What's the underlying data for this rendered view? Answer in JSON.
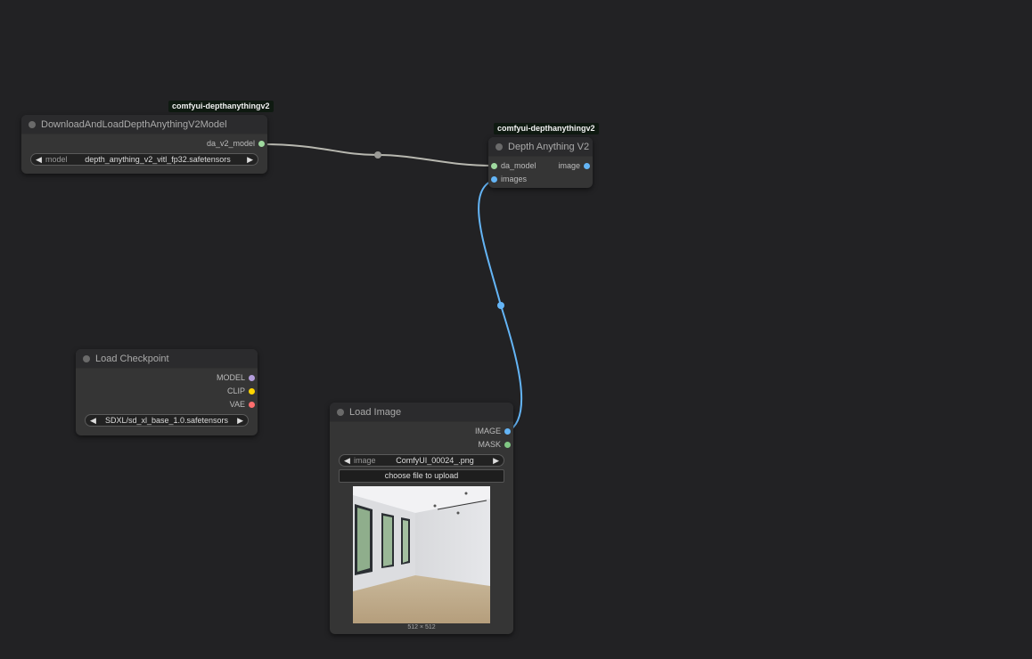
{
  "badges": {
    "download_node": "comfyui-depthanythingv2",
    "depth_node": "comfyui-depthanythingv2"
  },
  "download_node": {
    "title": "DownloadAndLoadDepthAnythingV2Model",
    "output": "da_v2_model",
    "widget_label": "model",
    "widget_value": "depth_anything_v2_vitl_fp32.safetensors"
  },
  "depth_node": {
    "title": "Depth Anything V2",
    "input_model": "da_model",
    "input_images": "images",
    "output_image": "image"
  },
  "checkpoint_node": {
    "title": "Load Checkpoint",
    "outputs": [
      "MODEL",
      "CLIP",
      "VAE"
    ],
    "widget_value": "SDXL/sd_xl_base_1.0.safetensors"
  },
  "image_node": {
    "title": "Load Image",
    "outputs": [
      "IMAGE",
      "MASK"
    ],
    "widget_label": "image",
    "widget_value": "ComfyUI_00024_.png",
    "upload_button": "choose file to upload",
    "preview_size": "512 × 512"
  },
  "colors": {
    "model_link": "#b8b8b0",
    "image_link": "#64b5f6",
    "model_dot": "#9fd99f",
    "image_dot": "#64b5f6",
    "mask_dot": "#81c784",
    "ckpt_model_dot": "#b39ddb",
    "clip_dot": "#ffd500",
    "vae_dot": "#ff6e6e"
  }
}
